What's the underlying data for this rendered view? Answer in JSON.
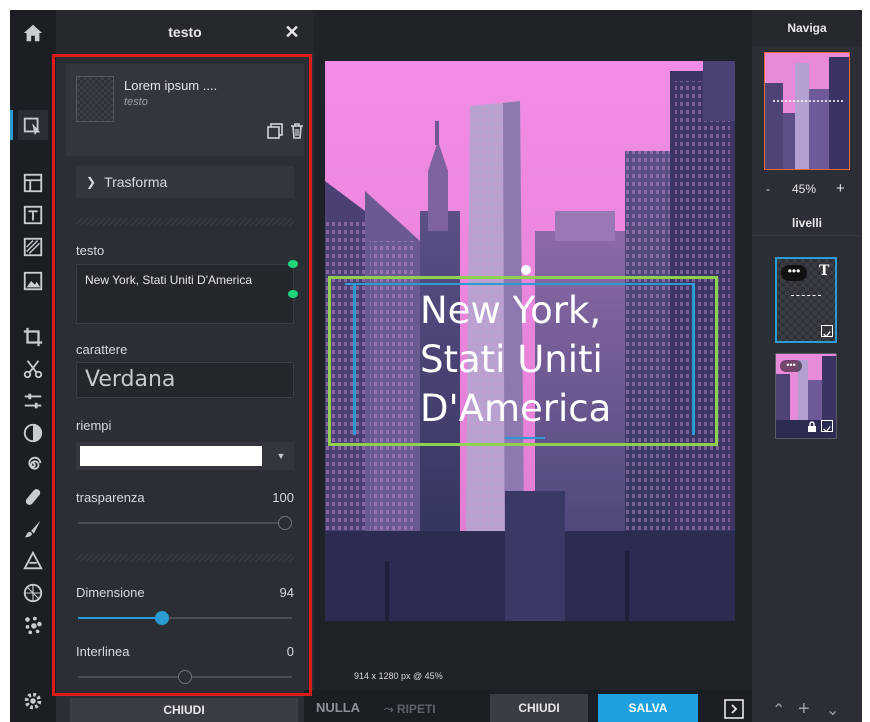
{
  "rail": {
    "items": [
      "home-icon",
      "pointer-icon",
      "layout-icon",
      "text-tool-icon",
      "pattern-icon",
      "image-icon",
      "crop-icon",
      "cut-icon",
      "adjust-icon",
      "contrast-icon",
      "spiral-icon",
      "bandage-icon",
      "brush-icon",
      "shape-icon",
      "pattern-circle-icon",
      "dots-icon",
      "settings-icon"
    ]
  },
  "panel": {
    "title": "testo",
    "close": "✕",
    "layer_name": "Lorem ipsum ....",
    "layer_type": "testo",
    "transform": "Trasforma",
    "text_label": "testo",
    "text_value": "New York, Stati Uniti D'America",
    "font_label": "carattere",
    "font_value": "Verdana",
    "fill_label": "riempi",
    "fill_color": "#ffffff",
    "opacity_label": "trasparenza",
    "opacity_value": "100",
    "size_label": "Dimensione",
    "size_value": "94",
    "leading_label": "Interlinea",
    "leading_value": "0",
    "close_button": "CHIUDI"
  },
  "canvas": {
    "text_lines": [
      "New York,",
      "Stati Uniti",
      "D'America"
    ],
    "dimensions": "914 x 1280 px @ 45%"
  },
  "bottom": {
    "undo": "NULLA",
    "redo": "⤳ RIPETI",
    "close": "CHIUDI",
    "save": "SALVA"
  },
  "right": {
    "navigator_title": "Naviga",
    "zoom_minus": "-",
    "zoom_value": "45%",
    "zoom_plus": "+",
    "layers_title": "livelli"
  },
  "colors": {
    "accent": "#2b9bd3",
    "save": "#1e9fe0",
    "highlight": "#e01b1b",
    "selection": "#8fd14f"
  }
}
